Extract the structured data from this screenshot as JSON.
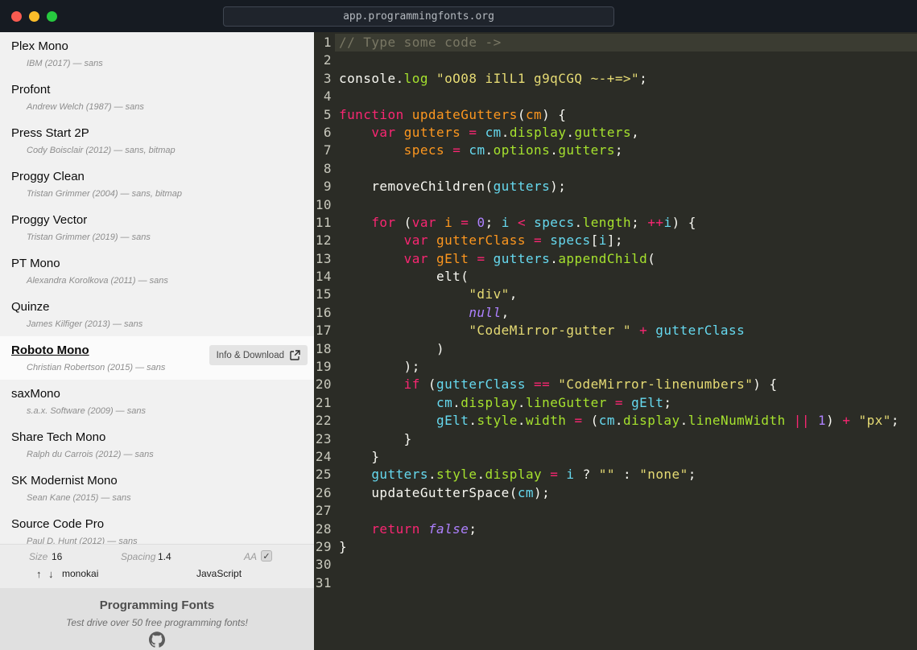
{
  "browser": {
    "url": "app.programmingfonts.org"
  },
  "sidebar": {
    "fonts": [
      {
        "name": "Plex Mono",
        "meta": "IBM (2017) — sans"
      },
      {
        "name": "Profont",
        "meta": "Andrew Welch (1987) — sans"
      },
      {
        "name": "Press Start 2P",
        "meta": "Cody Boisclair (2012) — sans, bitmap"
      },
      {
        "name": "Proggy Clean",
        "meta": "Tristan Grimmer (2004) — sans, bitmap"
      },
      {
        "name": "Proggy Vector",
        "meta": "Tristan Grimmer (2019) — sans"
      },
      {
        "name": "PT Mono",
        "meta": "Alexandra Korolkova (2011) — sans"
      },
      {
        "name": "Quinze",
        "meta": "James Kilfiger (2013) — sans"
      },
      {
        "name": "Roboto Mono",
        "meta": "Christian Robertson (2015) — sans",
        "selected": true,
        "action": "Info & Download"
      },
      {
        "name": "saxMono",
        "meta": "s.a.x. Software (2009) — sans"
      },
      {
        "name": "Share Tech Mono",
        "meta": "Ralph du Carrois (2012) — sans"
      },
      {
        "name": "SK Modernist Mono",
        "meta": "Sean Kane (2015) — sans"
      },
      {
        "name": "Source Code Pro",
        "meta": "Paul D. Hunt (2012) — sans"
      }
    ],
    "controls": {
      "size_label": "Size",
      "size_value": "16",
      "spacing_label": "Spacing",
      "spacing_value": "1.4",
      "aa_label": "AA",
      "aa_checked": true,
      "check_glyph": "✓",
      "theme_up": "↑",
      "theme_down": "↓",
      "theme_value": "monokai",
      "language_value": "JavaScript"
    },
    "footer": {
      "title": "Programming Fonts",
      "subtitle": "Test drive over 50 free programming fonts!"
    }
  },
  "editor": {
    "theme": "monokai",
    "active_line": 1,
    "colors": {
      "background": "#2b2c26",
      "active_line": "#3b3c32",
      "line_number": "#c9c9bd",
      "comment": "#797764",
      "keyword": "#f92672",
      "definition": "#fd971f",
      "variable": "#66d9ef",
      "property": "#a6e22e",
      "string": "#e6db74",
      "atom": "#ae81ff",
      "plain": "#f8f8f2"
    },
    "lines": [
      [
        [
          "c",
          "// Type some code ->"
        ]
      ],
      [],
      [
        [
          "pl",
          "console."
        ],
        [
          "prop",
          "log"
        ],
        [
          "pl",
          " "
        ],
        [
          "str",
          "\"oO08 iIlL1 g9qCGQ ~-+=>\""
        ],
        [
          "pl",
          ";"
        ]
      ],
      [],
      [
        [
          "kw",
          "function"
        ],
        [
          "pl",
          " "
        ],
        [
          "def",
          "updateGutters"
        ],
        [
          "pl",
          "("
        ],
        [
          "def",
          "cm"
        ],
        [
          "pl",
          ") {"
        ]
      ],
      [
        [
          "pl",
          "    "
        ],
        [
          "kw",
          "var"
        ],
        [
          "pl",
          " "
        ],
        [
          "def",
          "gutters"
        ],
        [
          "pl",
          " "
        ],
        [
          "kw",
          "="
        ],
        [
          "pl",
          " "
        ],
        [
          "v2",
          "cm"
        ],
        [
          "pl",
          "."
        ],
        [
          "prop",
          "display"
        ],
        [
          "pl",
          "."
        ],
        [
          "prop",
          "gutters"
        ],
        [
          "pl",
          ","
        ]
      ],
      [
        [
          "pl",
          "        "
        ],
        [
          "def",
          "specs"
        ],
        [
          "pl",
          " "
        ],
        [
          "kw",
          "="
        ],
        [
          "pl",
          " "
        ],
        [
          "v2",
          "cm"
        ],
        [
          "pl",
          "."
        ],
        [
          "prop",
          "options"
        ],
        [
          "pl",
          "."
        ],
        [
          "prop",
          "gutters"
        ],
        [
          "pl",
          ";"
        ]
      ],
      [],
      [
        [
          "pl",
          "    removeChildren("
        ],
        [
          "v2",
          "gutters"
        ],
        [
          "pl",
          ");"
        ]
      ],
      [],
      [
        [
          "pl",
          "    "
        ],
        [
          "kw",
          "for"
        ],
        [
          "pl",
          " ("
        ],
        [
          "kw",
          "var"
        ],
        [
          "pl",
          " "
        ],
        [
          "def",
          "i"
        ],
        [
          "pl",
          " "
        ],
        [
          "kw",
          "="
        ],
        [
          "pl",
          " "
        ],
        [
          "num",
          "0"
        ],
        [
          "pl",
          "; "
        ],
        [
          "v2",
          "i"
        ],
        [
          "pl",
          " "
        ],
        [
          "kw",
          "<"
        ],
        [
          "pl",
          " "
        ],
        [
          "v2",
          "specs"
        ],
        [
          "pl",
          "."
        ],
        [
          "prop",
          "length"
        ],
        [
          "pl",
          "; "
        ],
        [
          "kw",
          "++"
        ],
        [
          "v2",
          "i"
        ],
        [
          "pl",
          ") {"
        ]
      ],
      [
        [
          "pl",
          "        "
        ],
        [
          "kw",
          "var"
        ],
        [
          "pl",
          " "
        ],
        [
          "def",
          "gutterClass"
        ],
        [
          "pl",
          " "
        ],
        [
          "kw",
          "="
        ],
        [
          "pl",
          " "
        ],
        [
          "v2",
          "specs"
        ],
        [
          "pl",
          "["
        ],
        [
          "v2",
          "i"
        ],
        [
          "pl",
          "];"
        ]
      ],
      [
        [
          "pl",
          "        "
        ],
        [
          "kw",
          "var"
        ],
        [
          "pl",
          " "
        ],
        [
          "def",
          "gElt"
        ],
        [
          "pl",
          " "
        ],
        [
          "kw",
          "="
        ],
        [
          "pl",
          " "
        ],
        [
          "v2",
          "gutters"
        ],
        [
          "pl",
          "."
        ],
        [
          "prop",
          "appendChild"
        ],
        [
          "pl",
          "("
        ]
      ],
      [
        [
          "pl",
          "            elt("
        ]
      ],
      [
        [
          "pl",
          "                "
        ],
        [
          "str",
          "\"div\""
        ],
        [
          "pl",
          ","
        ]
      ],
      [
        [
          "pl",
          "                "
        ],
        [
          "atom",
          "null"
        ],
        [
          "pl",
          ","
        ]
      ],
      [
        [
          "pl",
          "                "
        ],
        [
          "str",
          "\"CodeMirror-gutter \""
        ],
        [
          "pl",
          " "
        ],
        [
          "kw",
          "+"
        ],
        [
          "pl",
          " "
        ],
        [
          "v2",
          "gutterClass"
        ]
      ],
      [
        [
          "pl",
          "            )"
        ]
      ],
      [
        [
          "pl",
          "        );"
        ]
      ],
      [
        [
          "pl",
          "        "
        ],
        [
          "kw",
          "if"
        ],
        [
          "pl",
          " ("
        ],
        [
          "v2",
          "gutterClass"
        ],
        [
          "pl",
          " "
        ],
        [
          "kw",
          "=="
        ],
        [
          "pl",
          " "
        ],
        [
          "str",
          "\"CodeMirror-linenumbers\""
        ],
        [
          "pl",
          ") {"
        ]
      ],
      [
        [
          "pl",
          "            "
        ],
        [
          "v2",
          "cm"
        ],
        [
          "pl",
          "."
        ],
        [
          "prop",
          "display"
        ],
        [
          "pl",
          "."
        ],
        [
          "prop",
          "lineGutter"
        ],
        [
          "pl",
          " "
        ],
        [
          "kw",
          "="
        ],
        [
          "pl",
          " "
        ],
        [
          "v2",
          "gElt"
        ],
        [
          "pl",
          ";"
        ]
      ],
      [
        [
          "pl",
          "            "
        ],
        [
          "v2",
          "gElt"
        ],
        [
          "pl",
          "."
        ],
        [
          "prop",
          "style"
        ],
        [
          "pl",
          "."
        ],
        [
          "prop",
          "width"
        ],
        [
          "pl",
          " "
        ],
        [
          "kw",
          "="
        ],
        [
          "pl",
          " ("
        ],
        [
          "v2",
          "cm"
        ],
        [
          "pl",
          "."
        ],
        [
          "prop",
          "display"
        ],
        [
          "pl",
          "."
        ],
        [
          "prop",
          "lineNumWidth"
        ],
        [
          "pl",
          " "
        ],
        [
          "kw",
          "||"
        ],
        [
          "pl",
          " "
        ],
        [
          "num",
          "1"
        ],
        [
          "pl",
          ") "
        ],
        [
          "kw",
          "+"
        ],
        [
          "pl",
          " "
        ],
        [
          "str",
          "\"px\""
        ],
        [
          "pl",
          ";"
        ]
      ],
      [
        [
          "pl",
          "        }"
        ]
      ],
      [
        [
          "pl",
          "    }"
        ]
      ],
      [
        [
          "pl",
          "    "
        ],
        [
          "v2",
          "gutters"
        ],
        [
          "pl",
          "."
        ],
        [
          "prop",
          "style"
        ],
        [
          "pl",
          "."
        ],
        [
          "prop",
          "display"
        ],
        [
          "pl",
          " "
        ],
        [
          "kw",
          "="
        ],
        [
          "pl",
          " "
        ],
        [
          "v2",
          "i"
        ],
        [
          "pl",
          " ? "
        ],
        [
          "str",
          "\"\""
        ],
        [
          "pl",
          " : "
        ],
        [
          "str",
          "\"none\""
        ],
        [
          "pl",
          ";"
        ]
      ],
      [
        [
          "pl",
          "    updateGutterSpace("
        ],
        [
          "v2",
          "cm"
        ],
        [
          "pl",
          ");"
        ]
      ],
      [],
      [
        [
          "pl",
          "    "
        ],
        [
          "kw",
          "return"
        ],
        [
          "pl",
          " "
        ],
        [
          "atom",
          "false"
        ],
        [
          "pl",
          ";"
        ]
      ],
      [
        [
          "pl",
          "}"
        ]
      ],
      [],
      []
    ]
  }
}
